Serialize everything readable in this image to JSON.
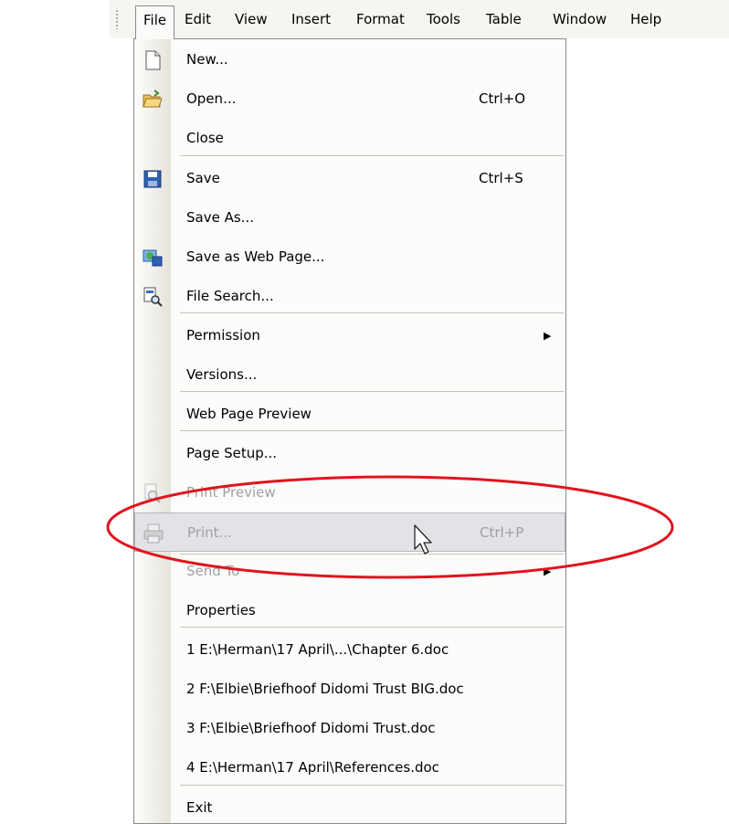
{
  "menubar": {
    "items": [
      {
        "label": "File"
      },
      {
        "label": "Edit"
      },
      {
        "label": "View"
      },
      {
        "label": "Insert"
      },
      {
        "label": "Format"
      },
      {
        "label": "Tools"
      },
      {
        "label": "Table"
      },
      {
        "label": "Window"
      },
      {
        "label": "Help"
      }
    ]
  },
  "file_menu": {
    "items": [
      {
        "label": "New...",
        "icon": "new-document-icon"
      },
      {
        "label": "Open...",
        "shortcut": "Ctrl+O",
        "icon": "open-folder-icon"
      },
      {
        "label": "Close"
      },
      {
        "label": "Save",
        "shortcut": "Ctrl+S",
        "icon": "save-disk-icon"
      },
      {
        "label": "Save As..."
      },
      {
        "label": "Save as Web Page...",
        "icon": "web-page-save-icon"
      },
      {
        "label": "File Search...",
        "icon": "file-search-icon"
      },
      {
        "label": "Permission",
        "submenu_arrow": "▶"
      },
      {
        "label": "Versions..."
      },
      {
        "label": "Web Page Preview"
      },
      {
        "label": "Page Setup..."
      },
      {
        "label": "Print Preview",
        "icon": "print-preview-icon",
        "disabled": true
      },
      {
        "label": "Print...",
        "shortcut": "Ctrl+P",
        "icon": "printer-icon",
        "disabled": true,
        "highlighted": true
      },
      {
        "label": "Send To",
        "submenu_arrow": "▶",
        "disabled": true
      },
      {
        "label": "Properties"
      },
      {
        "label": "1 E:\\Herman\\17 April\\...\\Chapter 6.doc"
      },
      {
        "label": "2 F:\\Elbie\\Briefhoof Didomi Trust BIG.doc"
      },
      {
        "label": "3 F:\\Elbie\\Briefhoof Didomi Trust.doc"
      },
      {
        "label": "4 E:\\Herman\\17 April\\References.doc"
      },
      {
        "label": "Exit"
      }
    ]
  },
  "colors": {
    "annotation_ellipse": "#e0141e",
    "menu_highlight": "#e2e3e6",
    "disabled_text": "#a0a0a0"
  }
}
